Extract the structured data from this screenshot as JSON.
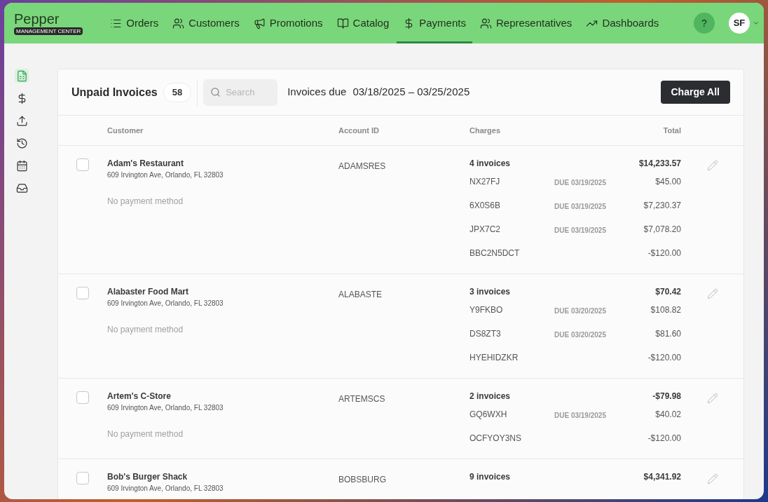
{
  "app": {
    "name": "Pepper",
    "subtitle": "MANAGEMENT CENTER"
  },
  "nav": [
    {
      "kind": "list",
      "label": "Orders",
      "selected": false
    },
    {
      "kind": "people",
      "label": "Customers",
      "selected": false
    },
    {
      "kind": "megaphone",
      "label": "Promotions",
      "selected": false
    },
    {
      "kind": "book",
      "label": "Catalog",
      "selected": false
    },
    {
      "kind": "dollar",
      "label": "Payments",
      "selected": true
    },
    {
      "kind": "people",
      "label": "Representatives",
      "selected": false
    },
    {
      "kind": "trend",
      "label": "Dashboards",
      "selected": false
    }
  ],
  "help": "?",
  "avatar": "SF",
  "sidebar": {
    "items": [
      {
        "kind": "sheet",
        "selected": true
      },
      {
        "kind": "dollar",
        "selected": false
      },
      {
        "kind": "upload",
        "selected": false
      },
      {
        "kind": "history",
        "selected": false
      },
      {
        "kind": "calendar",
        "selected": false
      },
      {
        "kind": "inbox",
        "selected": false
      }
    ]
  },
  "toolbar": {
    "title": "Unpaid Invoices",
    "count": "58",
    "search": {
      "placeholder": "Search"
    },
    "range_label": "Invoices due",
    "range": "03/18/2025 – 03/25/2025",
    "action": "Charge All"
  },
  "table": {
    "columns": [
      "Customer",
      "Account ID",
      "Charges",
      "Total"
    ],
    "rows": [
      {
        "checked": false,
        "customer": "Adam's Restaurant",
        "address": "609 Irvington Ave, Orlando, FL 32803",
        "payment": "No payment method",
        "account": "ADAMSRES",
        "summary": "4 invoices",
        "total": "$14,233.57",
        "invoices": [
          {
            "id": "NX27FJ",
            "due": "DUE 03/19/2025",
            "amount": "$45.00"
          },
          {
            "id": "6X0S6B",
            "due": "DUE 03/19/2025",
            "amount": "$7,230.37"
          },
          {
            "id": "JPX7C2",
            "due": "DUE 03/19/2025",
            "amount": "$7,078.20"
          },
          {
            "id": "BBC2N5DCT",
            "amount": "-$120.00"
          }
        ]
      },
      {
        "checked": false,
        "customer": "Alabaster Food Mart",
        "address": "609 Irvington Ave, Orlando, FL 32803",
        "payment": "No payment method",
        "account": "ALABASTE",
        "summary": "3 invoices",
        "total": "$70.42",
        "invoices": [
          {
            "id": "Y9FKBO",
            "due": "DUE 03/20/2025",
            "amount": "$108.82"
          },
          {
            "id": "DS8ZT3",
            "due": "DUE 03/20/2025",
            "amount": "$81.60"
          },
          {
            "id": "HYEHIDZKR",
            "amount": "-$120.00"
          }
        ]
      },
      {
        "checked": false,
        "customer": "Artem's C-Store",
        "address": "609 Irvington Ave, Orlando, FL 32803",
        "payment": "No payment method",
        "account": "ARTEMSCS",
        "summary": "2 invoices",
        "total": "-$79.98",
        "invoices": [
          {
            "id": "GQ6WXH",
            "due": "DUE 03/19/2025",
            "amount": "$40.02"
          },
          {
            "id": "OCFYOY3NS",
            "amount": "-$120.00"
          }
        ]
      },
      {
        "checked": false,
        "customer": "Bob's Burger Shack",
        "address": "609 Irvington Ave, Orlando, FL 32803",
        "account": "BOBSBURG",
        "summary": "9 invoices",
        "total": "$4,341.92",
        "invoices": []
      }
    ]
  }
}
